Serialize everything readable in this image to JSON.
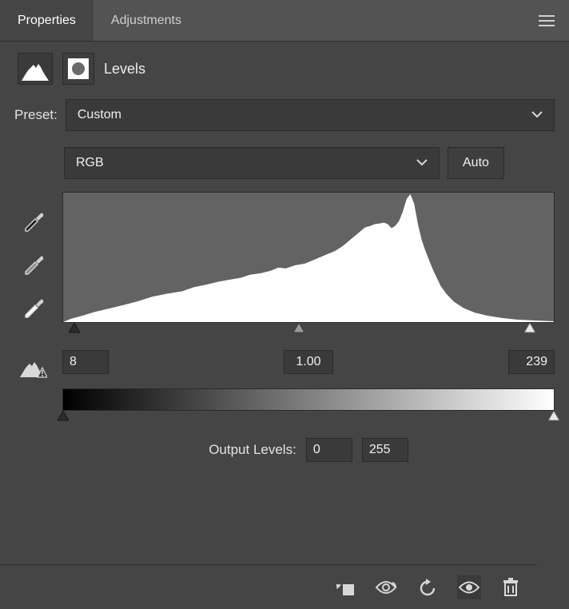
{
  "tabs": {
    "properties": "Properties",
    "adjustments": "Adjustments"
  },
  "header": {
    "title": "Levels"
  },
  "preset": {
    "label": "Preset:",
    "value": "Custom"
  },
  "channel": {
    "value": "RGB"
  },
  "autoButton": "Auto",
  "input_levels": {
    "black": "8",
    "gamma": "1.00",
    "white": "239"
  },
  "output": {
    "label": "Output Levels:",
    "black": "0",
    "white": "255"
  }
}
